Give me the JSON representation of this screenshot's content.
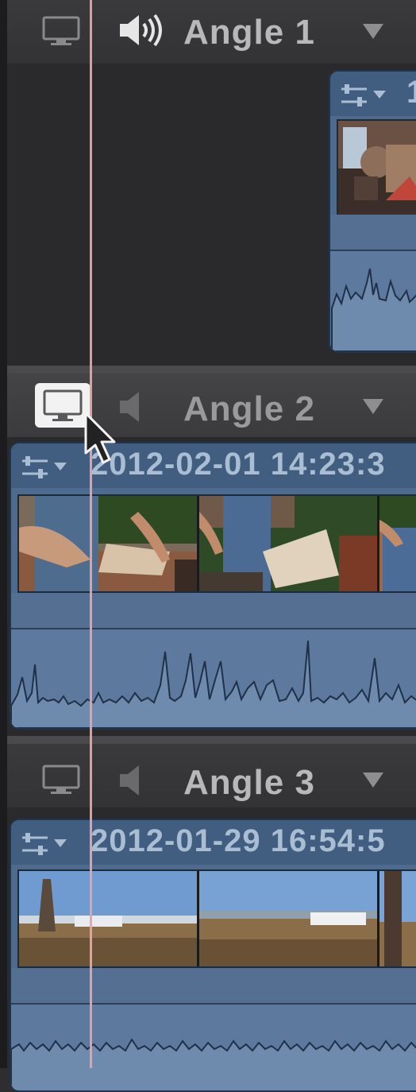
{
  "angles": [
    {
      "name": "Angle 1",
      "monitor_active": false,
      "audio_on": true
    },
    {
      "name": "Angle 2",
      "monitor_active": true,
      "audio_on": false
    },
    {
      "name": "Angle 3",
      "monitor_active": false,
      "audio_on": false
    }
  ],
  "clips": [
    {
      "title": "1"
    },
    {
      "title": "2012-02-01 14:23:3"
    },
    {
      "title": "2012-01-29 16:54:5"
    }
  ],
  "icons": {
    "monitor": "monitor-icon",
    "speaker": "speaker-icon",
    "dropdown": "triangle-down-icon",
    "clip_settings": "clip-settings-icon",
    "cursor": "mouse-pointer-icon"
  },
  "colors": {
    "clip_blue": "#4e6b8e",
    "playhead": "#e8a3a3",
    "active_monitor": "#f2f2f2"
  }
}
